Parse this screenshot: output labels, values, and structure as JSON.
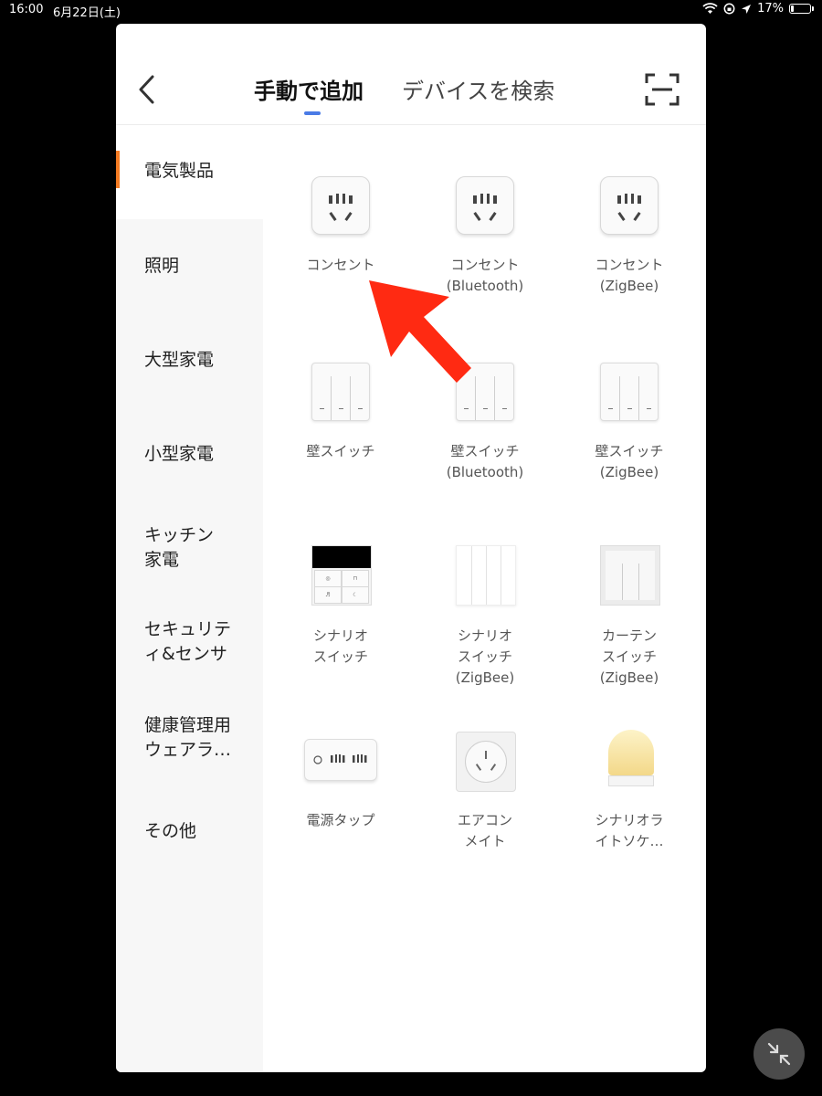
{
  "status_bar": {
    "time": "16:00",
    "date": "6月22日(土)",
    "battery_percent": "17%",
    "battery_level": 0.17
  },
  "header": {
    "tabs": [
      {
        "label": "手動で追加",
        "active": true
      },
      {
        "label": "デバイスを検索",
        "active": false
      }
    ]
  },
  "sidebar": {
    "items": [
      {
        "lines": [
          "電気製品"
        ],
        "active": true
      },
      {
        "lines": [
          "照明"
        ]
      },
      {
        "lines": [
          "大型家電"
        ]
      },
      {
        "lines": [
          "小型家電"
        ]
      },
      {
        "lines": [
          "キッチン",
          "家電"
        ]
      },
      {
        "lines": [
          "セキュリテ",
          "ィ&センサ"
        ]
      },
      {
        "lines": [
          "健康管理用",
          "ウェアラ…"
        ]
      },
      {
        "lines": [
          "その他"
        ]
      }
    ]
  },
  "devices": [
    {
      "icon": "socket-icon",
      "lines": [
        "コンセント"
      ]
    },
    {
      "icon": "socket-icon",
      "lines": [
        "コンセント",
        "(Bluetooth)"
      ]
    },
    {
      "icon": "socket-icon",
      "lines": [
        "コンセント",
        "(ZigBee)"
      ]
    },
    {
      "icon": "wall-switch-icon",
      "lines": [
        "壁スイッチ"
      ]
    },
    {
      "icon": "wall-switch-icon",
      "lines": [
        "壁スイッチ",
        "(Bluetooth)"
      ]
    },
    {
      "icon": "wall-switch-icon",
      "lines": [
        "壁スイッチ",
        "(ZigBee)"
      ]
    },
    {
      "icon": "scene-switch-icon",
      "lines": [
        "シナリオ",
        "スイッチ"
      ]
    },
    {
      "icon": "scene-switch-zigbee-icon",
      "lines": [
        "シナリオ",
        "スイッチ",
        "(ZigBee)"
      ]
    },
    {
      "icon": "curtain-switch-icon",
      "lines": [
        "カーテン",
        "スイッチ",
        "(ZigBee)"
      ]
    },
    {
      "icon": "power-strip-icon",
      "lines": [
        "電源タップ"
      ]
    },
    {
      "icon": "aircon-mate-icon",
      "lines": [
        "エアコン",
        "メイト"
      ]
    },
    {
      "icon": "scene-light-socket-icon",
      "lines": [
        "シナリオラ",
        "イトソケ…"
      ]
    }
  ],
  "colors": {
    "active_indicator": "#f47b22",
    "tab_underline": "#4a7be6",
    "annotation_arrow": "#ff2a12"
  }
}
